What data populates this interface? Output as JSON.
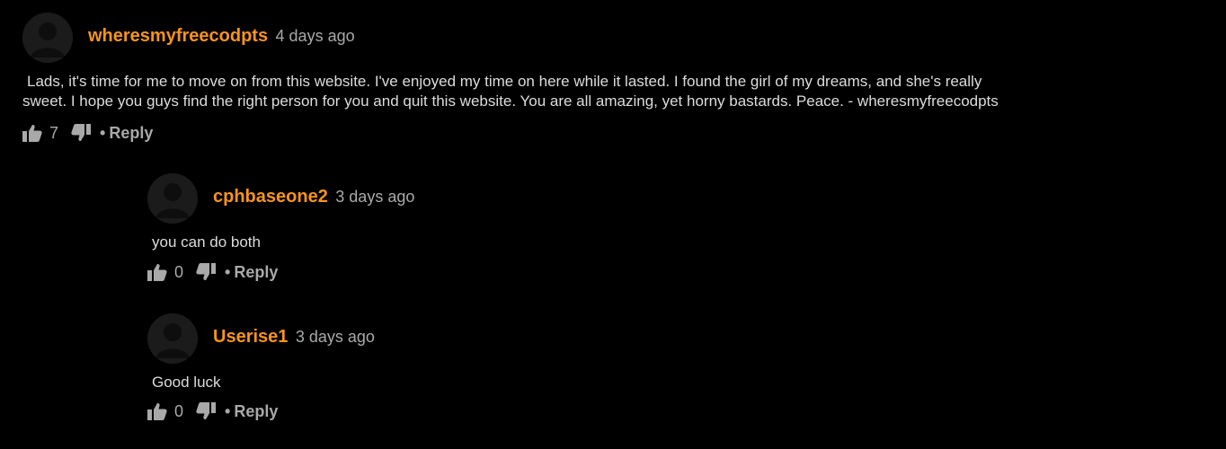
{
  "colors": {
    "background": "#000000",
    "username": "#f7941d",
    "meta": "#a9a9a9",
    "text": "#dcdcdc"
  },
  "comments": [
    {
      "username": "wheresmyfreecodpts",
      "time": "4 days ago",
      "text_line1": "Lads, it's time for me to move on from this website. I've enjoyed my time on here while it lasted. I found the girl of my dreams, and she's really",
      "text_line2": "sweet. I hope you guys find the right person for you and quit this website. You are all amazing, yet horny bastards. Peace. - wheresmyfreecodpts",
      "likes": "7",
      "reply_label": "Reply",
      "separator": "•"
    },
    {
      "username": "cphbaseone2",
      "time": "3 days ago",
      "text_line1": "you can do both",
      "likes": "0",
      "reply_label": "Reply",
      "separator": "•"
    },
    {
      "username": "Userise1",
      "time": "3 days ago",
      "text_line1": "Good luck",
      "likes": "0",
      "reply_label": "Reply",
      "separator": "•"
    }
  ],
  "icons": {
    "avatar": "default-avatar-icon",
    "like": "thumbs-up-icon",
    "dislike": "thumbs-down-icon"
  }
}
